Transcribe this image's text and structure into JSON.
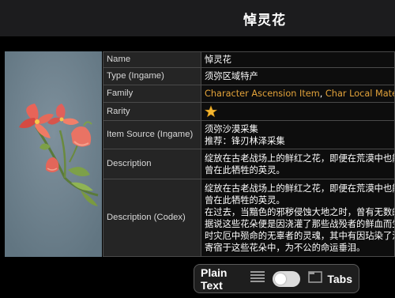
{
  "header": {
    "title": "悼灵花"
  },
  "rows": [
    {
      "key": "Name",
      "value": "悼灵花"
    },
    {
      "key": "Type (Ingame)",
      "value": "须弥区域特产"
    },
    {
      "key": "Family",
      "links": [
        "Character Ascension Item",
        "Char Local Mate"
      ],
      "separator": ", "
    },
    {
      "key": "Rarity",
      "stars": 1
    },
    {
      "key": "Item Source (Ingame)",
      "lines": [
        "须弥沙漠采集",
        "推荐：锋刃林泽采集"
      ]
    },
    {
      "key": "Description",
      "lines": [
        "绽放在古老战场上的鲜红之花，即便在荒漠中也能",
        "曾在此牺牲的英灵。"
      ]
    },
    {
      "key": "Description (Codex)",
      "lines": [
        "绽放在古老战场上的鲜红之花，即便在荒漠中也能",
        "曾在此牺牲的英灵。",
        "在过去，当黯色的邪秽侵蚀大地之时，曾有无数的",
        "据说这些花朵便是因浇灌了那些战殁者的鲜血而生",
        "时灾厄中殒命的无辜者的灵魂，其中有因玷染了污",
        "寄宿于这些花朵中，为不公的命运垂泪。"
      ]
    }
  ],
  "toggle": {
    "left_label": "Plain Text",
    "right_label": "Tabs",
    "state": "off"
  },
  "icons": {
    "rarity": "star-icon",
    "list": "list-icon",
    "tabs": "tabs-icon"
  },
  "colors": {
    "link": "#e3a33a",
    "star": "#f4b731",
    "background": "#000000"
  }
}
